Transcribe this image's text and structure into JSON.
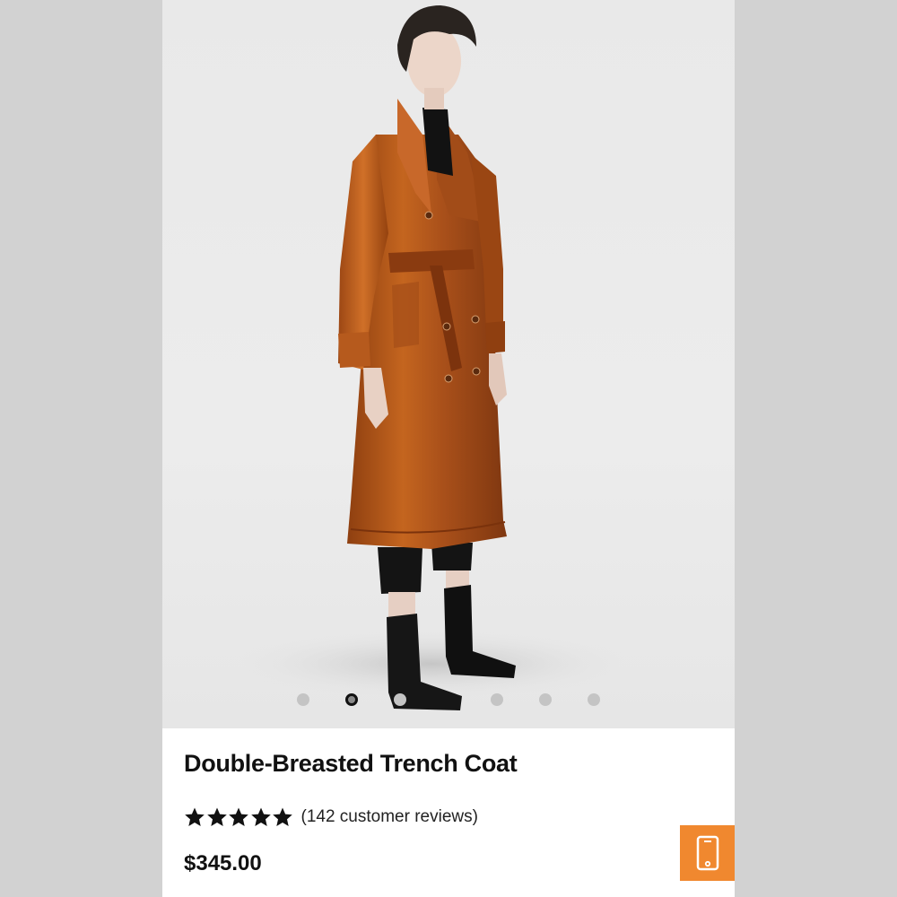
{
  "product": {
    "title": "Double-Breasted Trench Coat",
    "rating": 5,
    "rating_max": 5,
    "reviews_text": "(142 customer reviews)",
    "price": "$345.00"
  },
  "carousel": {
    "total_slides": 7,
    "active_index": 1
  },
  "actions": {
    "mobile_icon": "mobile-phone-icon"
  },
  "colors": {
    "accent": "#f0882f",
    "coat": "#b5581c",
    "page_background": "#d2d2d2"
  }
}
